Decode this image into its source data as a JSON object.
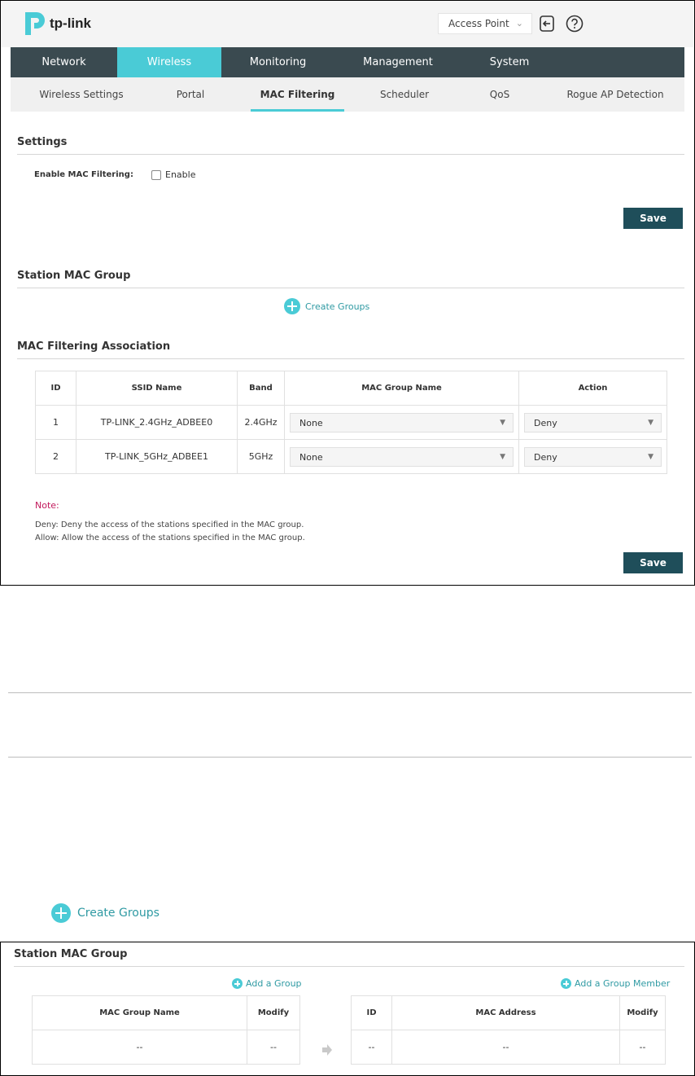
{
  "header": {
    "logo_text": "tp-link",
    "mode_select": "Access Point"
  },
  "main_nav": [
    {
      "label": "Network",
      "active": false
    },
    {
      "label": "Wireless",
      "active": true
    },
    {
      "label": "Monitoring",
      "active": false
    },
    {
      "label": "Management",
      "active": false
    },
    {
      "label": "System",
      "active": false
    }
  ],
  "sub_nav": [
    {
      "label": "Wireless Settings",
      "active": false
    },
    {
      "label": "Portal",
      "active": false
    },
    {
      "label": "MAC Filtering",
      "active": true
    },
    {
      "label": "Scheduler",
      "active": false
    },
    {
      "label": "QoS",
      "active": false
    },
    {
      "label": "Rogue AP Detection",
      "active": false
    }
  ],
  "settings": {
    "title": "Settings",
    "enable_label": "Enable MAC Filtering:",
    "enable_checkbox_label": "Enable",
    "enabled": false,
    "save_label": "Save"
  },
  "station_group": {
    "title": "Station MAC Group",
    "create_label": "Create Groups"
  },
  "association": {
    "title": "MAC Filtering Association",
    "columns": [
      "ID",
      "SSID Name",
      "Band",
      "MAC Group Name",
      "Action"
    ],
    "rows": [
      {
        "id": "1",
        "ssid": "TP-LINK_2.4GHz_ADBEE0",
        "band": "2.4GHz",
        "group": "None",
        "action": "Deny"
      },
      {
        "id": "2",
        "ssid": "TP-LINK_5GHz_ADBEE1",
        "band": "5GHz",
        "group": "None",
        "action": "Deny"
      }
    ],
    "note_title": "Note:",
    "note_deny": "Deny: Deny the access of the stations specified in the MAC group.",
    "note_allow": "Allow: Allow the access of the stations specified in the MAC group.",
    "save_label": "Save"
  },
  "large_create": {
    "label": "Create Groups"
  },
  "expanded_group": {
    "title": "Station MAC Group",
    "add_group_label": "Add a Group",
    "add_member_label": "Add a Group Member",
    "group_columns": [
      "MAC Group Name",
      "Modify"
    ],
    "group_row": [
      "--",
      "--"
    ],
    "member_columns": [
      "ID",
      "MAC Address",
      "Modify"
    ],
    "member_row": [
      "--",
      "--",
      "--"
    ]
  },
  "colors": {
    "accent": "#4acbd6",
    "nav_bg": "#3a4a50",
    "button": "#1f4e5a",
    "note": "#c2185b"
  }
}
